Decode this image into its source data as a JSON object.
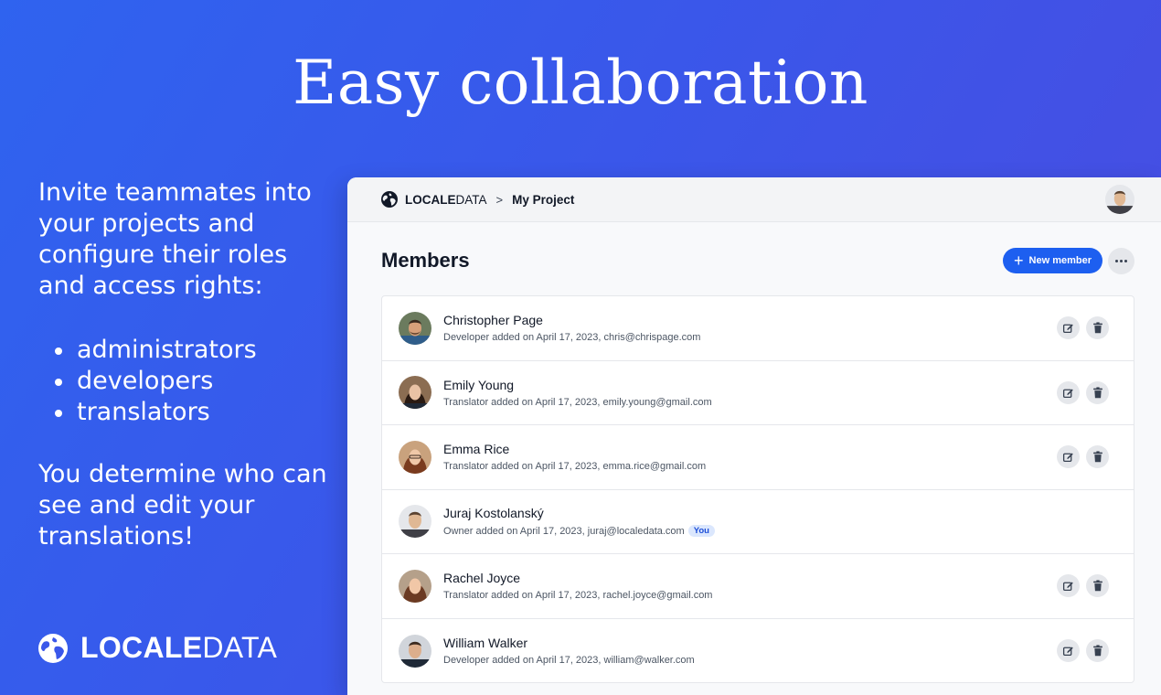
{
  "headline": "Easy collaboration",
  "intro": "Invite teammates into your projects and configure their roles and access rights:",
  "roles": [
    "administrators",
    "developers",
    "translators"
  ],
  "closing": "You determine who can see and edit your translations!",
  "brand": {
    "bold": "LOCALE",
    "light": "DATA"
  },
  "app": {
    "breadcrumb": {
      "logo_bold": "LOCALE",
      "logo_light": "DATA",
      "separator": ">",
      "project": "My Project"
    },
    "section_title": "Members",
    "new_member_label": "New member",
    "members": [
      {
        "name": "Christopher Page",
        "role_line": "Developer added on April 17, 2023, chris@chrispage.com",
        "you": ""
      },
      {
        "name": "Emily Young",
        "role_line": "Translator added on April 17, 2023, emily.young@gmail.com",
        "you": ""
      },
      {
        "name": "Emma Rice",
        "role_line": "Translator added on April 17, 2023, emma.rice@gmail.com",
        "you": ""
      },
      {
        "name": "Juraj Kostolanský",
        "role_line": "Owner added on April 17, 2023, juraj@localedata.com",
        "you": "You"
      },
      {
        "name": "Rachel Joyce",
        "role_line": "Translator added on April 17, 2023, rachel.joyce@gmail.com",
        "you": ""
      },
      {
        "name": "William Walker",
        "role_line": "Developer added on April 17, 2023, william@walker.com",
        "you": ""
      }
    ]
  },
  "colors": {
    "accent": "#1d5ff0",
    "background_start": "#2f63ef",
    "background_end": "#4a4be0"
  }
}
